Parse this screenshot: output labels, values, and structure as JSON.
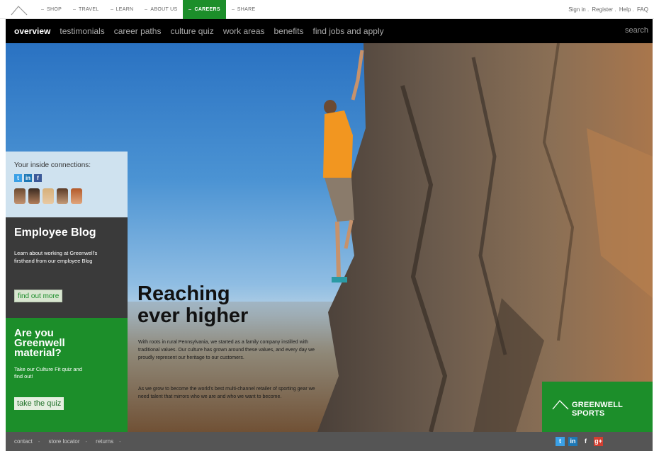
{
  "top_nav": {
    "items": [
      "SHOP",
      "TRAVEL",
      "LEARN",
      "ABOUT US",
      "CAREERS",
      "SHARE"
    ],
    "active": "CAREERS"
  },
  "account_links": [
    "Sign in",
    "Register",
    "Help",
    "FAQ"
  ],
  "main_nav": {
    "items": [
      "overview",
      "testimonials",
      "career paths",
      "culture quiz",
      "work areas",
      "benefits",
      "find jobs and apply"
    ],
    "search_label": "search"
  },
  "connections": {
    "title": "Your inside connections:",
    "networks": [
      "twitter-icon",
      "linkedin-icon",
      "facebook-icon"
    ]
  },
  "blog": {
    "title": "Employee Blog",
    "text": "Learn about working at Greenwell's firsthand from our employee Blog",
    "button": "find out more"
  },
  "quiz": {
    "title": "Are you Greenwell material?",
    "text": "Take our Culture Fit quiz and find out!",
    "button": "take the quiz"
  },
  "hero": {
    "headline_line1": "Reaching",
    "headline_line2": "ever higher",
    "body1": "With roots in rural Pennsylvania, we started as a family company instilled with traditional values. Our culture has grown around these values, and every day we proudly represent our heritage to our customers.",
    "body2": "As we grow to become the world's best multi-channel retailer of sporting gear we need talent that mirrors who we are and who we want to become."
  },
  "brand": {
    "name": "GREENWELL SPORTS"
  },
  "footer": {
    "links": [
      "contact",
      "store locator",
      "returns"
    ],
    "socials": [
      "twitter-icon",
      "linkedin-icon",
      "facebook-icon",
      "google-plus-icon"
    ]
  },
  "colors": {
    "brand_green": "#1c8e2a",
    "nav_black": "#000000",
    "blog_gray": "#3a3a3a",
    "footer_gray": "#555555"
  }
}
